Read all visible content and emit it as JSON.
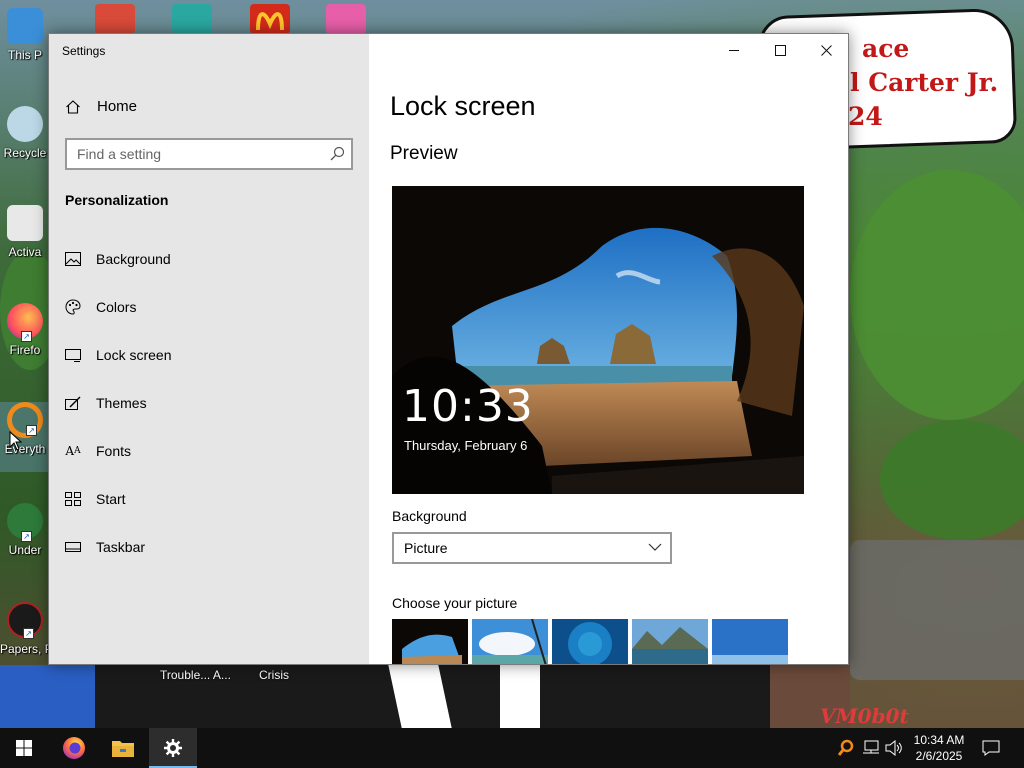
{
  "desktop": {
    "icons": [
      {
        "label": "This P"
      },
      {
        "label": "Recycle"
      },
      {
        "label": "Activa"
      },
      {
        "label": "Firefo"
      },
      {
        "label": "Everyth"
      },
      {
        "label": "Under"
      },
      {
        "label": "Papers, P"
      }
    ],
    "taskbar_captions": [
      "Trouble... A...",
      "Crisis"
    ],
    "sign_lines": [
      "ace",
      "l Carter Jr.",
      "24"
    ],
    "wallpaper_mark": "VM0b0t"
  },
  "window": {
    "title": "Settings",
    "controls": {
      "minimize": "—",
      "maximize": "☐",
      "close": "✕"
    }
  },
  "sidebar": {
    "home_label": "Home",
    "search_placeholder": "Find a setting",
    "section_title": "Personalization",
    "items": [
      {
        "label": "Background",
        "icon": "picture-icon"
      },
      {
        "label": "Colors",
        "icon": "palette-icon"
      },
      {
        "label": "Lock screen",
        "icon": "lock-screen-icon"
      },
      {
        "label": "Themes",
        "icon": "themes-icon"
      },
      {
        "label": "Fonts",
        "icon": "fonts-icon"
      },
      {
        "label": "Start",
        "icon": "start-grid-icon"
      },
      {
        "label": "Taskbar",
        "icon": "taskbar-icon"
      }
    ]
  },
  "main": {
    "page_title": "Lock screen",
    "preview_heading": "Preview",
    "preview_time": "10:33",
    "preview_date": "Thursday, February 6",
    "background_label": "Background",
    "background_value": "Picture",
    "choose_label": "Choose your picture"
  },
  "taskbar": {
    "clock_time": "10:34 AM",
    "clock_date": "2/6/2025",
    "active_app": "Settings",
    "accent": "#76b9ed"
  }
}
